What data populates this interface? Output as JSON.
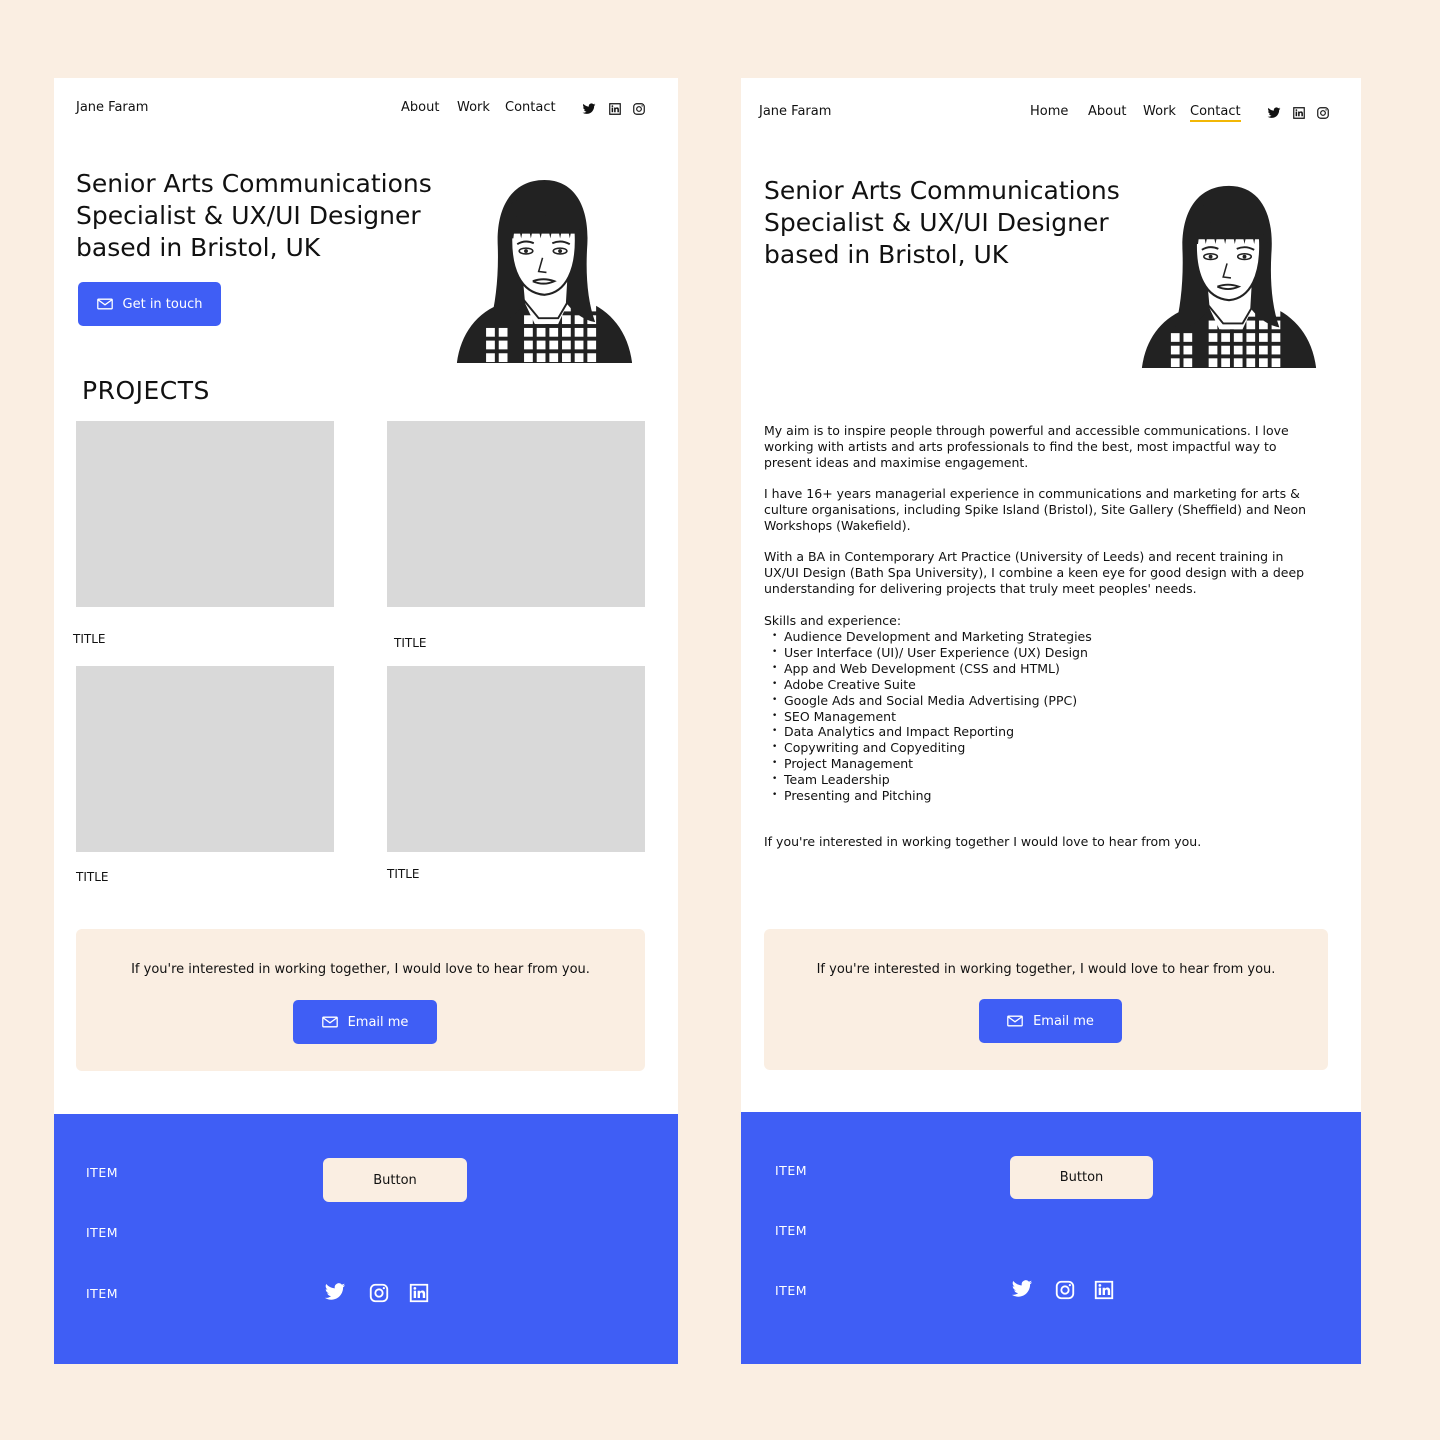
{
  "brand": "Jane Faram",
  "hero_title": [
    "Senior Arts Communications",
    "Specialist & UX/UI Designer",
    "based in Bristol, UK"
  ],
  "left_nav": [
    "About",
    "Work",
    "Contact"
  ],
  "right_nav": [
    "Home",
    "About",
    "Work",
    "Contact"
  ],
  "right_nav_active": "Contact",
  "social_icons": [
    "twitter-icon",
    "linkedin-icon",
    "instagram-icon"
  ],
  "get_in_touch_label": "Get in touch",
  "projects_heading": "PROJECTS",
  "project_titles": [
    "TITLE",
    "TITLE",
    "TITLE",
    "TITLE"
  ],
  "cta": {
    "text": "If you're interested in working together, I would love to hear from you.",
    "button_label": "Email me"
  },
  "footer": {
    "items": [
      "ITEM",
      "ITEM",
      "ITEM"
    ],
    "button_label": "Button",
    "icons": [
      "twitter-icon",
      "instagram-icon",
      "linkedin-icon"
    ]
  },
  "about": {
    "paragraphs": [
      "My aim is to inspire people through powerful and accessible communications. I love working with artists and arts professionals to find the best, most impactful way to present ideas and maximise engagement.",
      "I have 16+ years managerial experience in communications and marketing for arts & culture organisations, including Spike Island (Bristol), Site Gallery (Sheffield) and Neon Workshops (Wakefield).",
      "With a BA in Contemporary Art Practice (University of Leeds) and recent training in UX/UI Design (Bath Spa University), I combine a keen eye for good design with a deep understanding for delivering projects that truly meet peoples' needs."
    ],
    "skills_heading": "Skills and experience:",
    "skills": [
      "Audience Development and Marketing Strategies",
      "User Interface (UI)/ User Experience (UX) Design",
      "App and Web Development (CSS and HTML)",
      "Adobe Creative Suite",
      "Google Ads and Social Media Advertising (PPC)",
      "SEO Management",
      "Data Analytics and Impact Reporting",
      "Copywriting and Copyediting",
      "Project Management",
      "Team Leadership",
      "Presenting and Pitching"
    ],
    "closing": "If you're interested in working together I would love to hear from you."
  },
  "colors": {
    "accent": "#3f5ef5",
    "cream": "#faeee2",
    "placeholder": "#d9d9d9",
    "active_underline": "#f2b705"
  }
}
